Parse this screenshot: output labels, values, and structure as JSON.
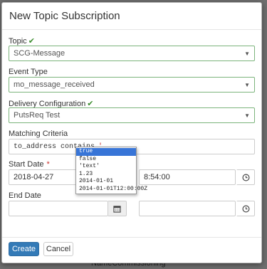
{
  "background": {
    "partial_text": "NameCommissioning"
  },
  "modal": {
    "title": "New Topic Subscription",
    "topic": {
      "label": "Topic",
      "value": "SCG-Message"
    },
    "event_type": {
      "label": "Event Type",
      "value": "mo_message_received"
    },
    "delivery": {
      "label": "Delivery Configuration",
      "value": "PutsReq Test"
    },
    "matching": {
      "label": "Matching Criteria",
      "value": "to_address contains",
      "quote": "'"
    },
    "start_date": {
      "label": "Start Date",
      "date": "2018-04-27",
      "time": "8:54:00"
    },
    "end_date": {
      "label": "End Date",
      "date": "",
      "time": ""
    },
    "footer": {
      "create_label": "Create",
      "cancel_label": "Cancel"
    }
  },
  "autocomplete": {
    "items": [
      "true",
      "false",
      "'text'",
      "1.23",
      "2014-01-01",
      "2014-01-01T12:00:00Z"
    ],
    "selected": "true"
  },
  "icons": {
    "check": "check-icon",
    "caret": "caret-down-icon",
    "calendar": "calendar-icon",
    "clock": "clock-icon"
  },
  "colors": {
    "primary": "#337ab7",
    "valid_border": "#7cb47c",
    "check": "#3c8d2f",
    "selected_item": "#3875d7"
  }
}
